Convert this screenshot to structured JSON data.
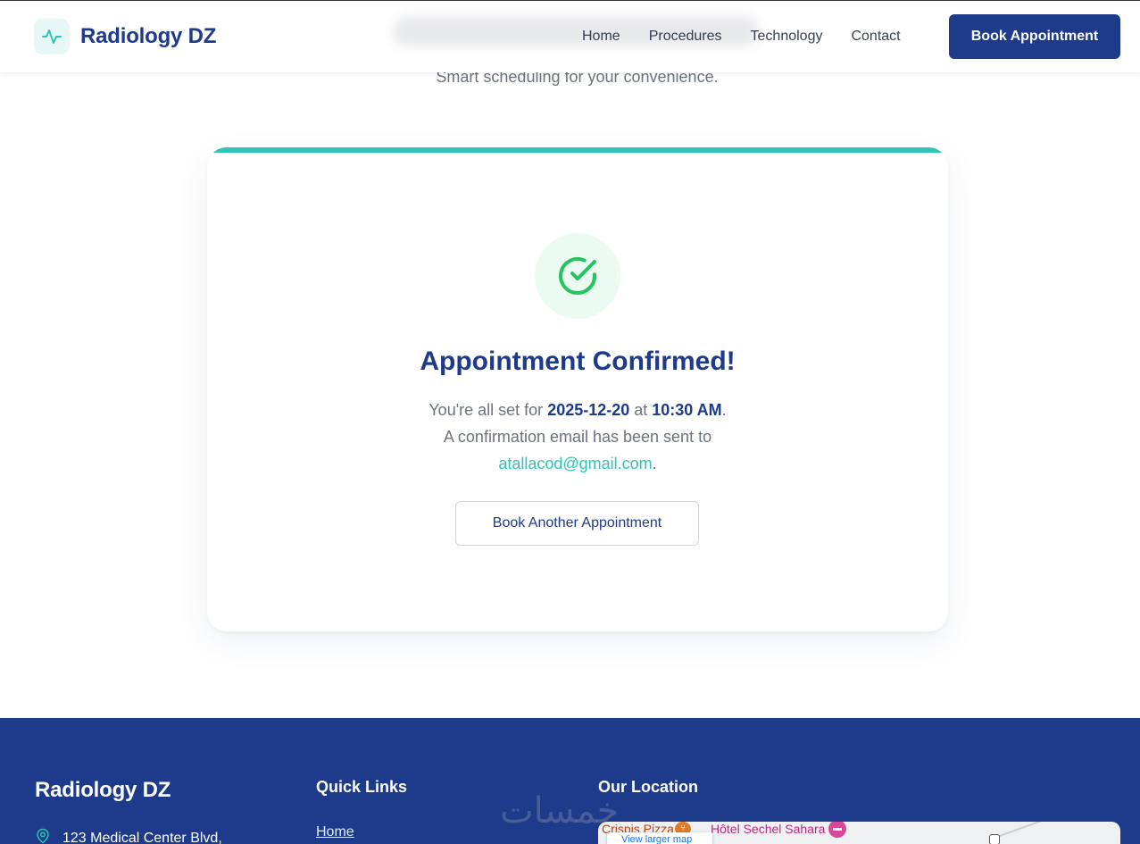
{
  "brand": {
    "name": "Radiology DZ",
    "accent": "#2ec4b6",
    "primary": "#1e3a8a"
  },
  "nav": {
    "items": [
      "Home",
      "Procedures",
      "Technology",
      "Contact"
    ],
    "cta_label": "Book Appointment"
  },
  "hero": {
    "subtitle": "Smart scheduling for your convenience."
  },
  "confirmation": {
    "icon": "check-circle-icon",
    "title": "Appointment Confirmed!",
    "line1_prefix": "You're all set for ",
    "date": "2025-12-20",
    "line1_mid": " at ",
    "time": "10:30 AM",
    "line1_suffix": ".",
    "line2": "A confirmation email has been sent to",
    "email": "atallacod@gmail.com",
    "line3_suffix": ".",
    "button_label": "Book Another Appointment"
  },
  "footer": {
    "brand": "Radiology DZ",
    "address": "123 Medical Center Blvd,",
    "quick_links_heading": "Quick Links",
    "quick_links": [
      "Home"
    ],
    "location_heading": "Our Location",
    "map": {
      "poi_food": "Crispis Pizza",
      "poi_hotel": "Hôtel Sechel Sahara",
      "view_larger": "View larger map"
    }
  },
  "watermark": "خمسات"
}
